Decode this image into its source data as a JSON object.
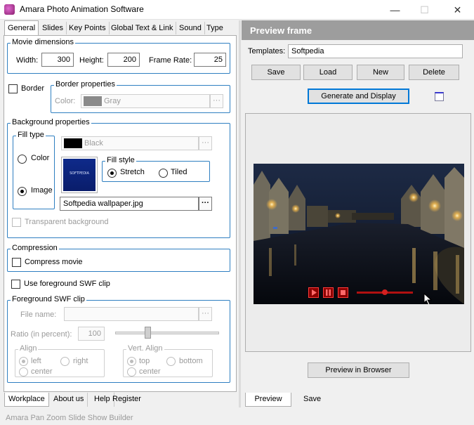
{
  "window": {
    "title": "Amara Photo Animation Software",
    "minimize": "—",
    "maximize": "☐",
    "close": "✕"
  },
  "tabs": [
    "General",
    "Slides",
    "Key Points",
    "Global Text & Link",
    "Sound",
    "Type"
  ],
  "movie_dimensions": {
    "title": "Movie dimensions",
    "width_label": "Width:",
    "width": "300",
    "height_label": "Height:",
    "height": "200",
    "frame_rate_label": "Frame Rate:",
    "frame_rate": "25"
  },
  "border": {
    "checkbox_label": "Border",
    "properties_title": "Border properties",
    "color_label": "Color:",
    "color_name": "Gray",
    "color_swatch": "#8a8a8a",
    "browse": "···"
  },
  "background": {
    "title": "Background properties",
    "fill_type_title": "Fill type",
    "color_option": "Color",
    "image_option": "Image",
    "selected_fill": "Image",
    "color_name": "Black",
    "color_swatch": "#000000",
    "browse": "···",
    "thumbnail_text": "SOFTPEDIA",
    "fill_style_title": "Fill style",
    "stretch_option": "Stretch",
    "tiled_option": "Tiled",
    "selected_style": "Stretch",
    "image_file": "Softpedia wallpaper.jpg",
    "transparent_label": "Transparent background"
  },
  "compression": {
    "title": "Compression",
    "checkbox_label": "Compress movie"
  },
  "foreground": {
    "use_label": "Use foreground SWF clip",
    "title": "Foreground SWF clip",
    "file_name_label": "File name:",
    "browse": "···",
    "ratio_label": "Ratio (in percent):",
    "ratio_value": "100",
    "ratio_slider_position": 0.3,
    "align_title": "Align",
    "align_left": "left",
    "align_right": "right",
    "align_center": "center",
    "valign_title": "Vert. Align",
    "valign_top": "top",
    "valign_bottom": "bottom",
    "valign_center": "center"
  },
  "bottom_tabs_left": [
    "Workplace",
    "About us",
    "Help",
    "Register"
  ],
  "preview": {
    "header": "Preview frame",
    "templates_label": "Templates:",
    "template_value": "Softpedia",
    "save_button": "Save",
    "load_button": "Load",
    "new_button": "New",
    "delete_button": "Delete",
    "generate_button": "Generate and Display",
    "browser_button": "Preview in Browser",
    "playback_position": 0.5
  },
  "bottom_tabs_right": [
    "Preview",
    "Save"
  ],
  "status_bar": "Amara Pan Zoom Slide Show Builder",
  "colors": {
    "group_border": "#2f7fc1",
    "preview_header": "#9d9d9d",
    "playback_red": "#8c0000"
  }
}
